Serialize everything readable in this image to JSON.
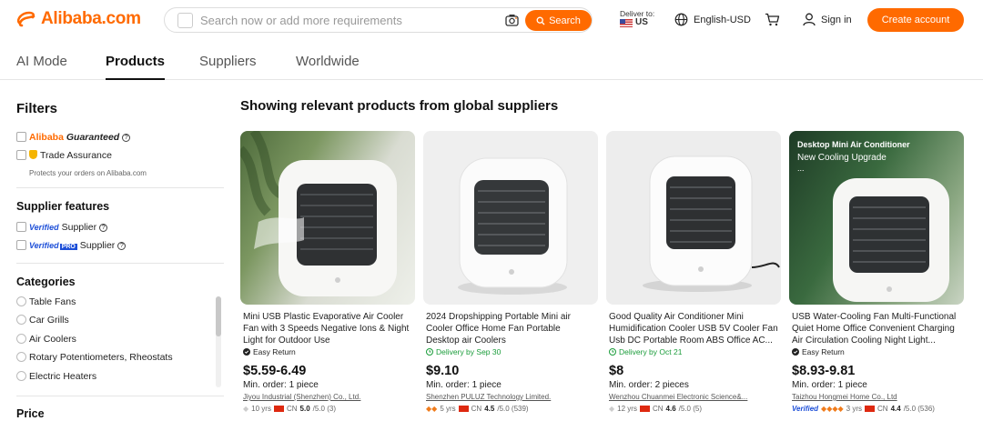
{
  "header": {
    "logo": "Alibaba.com",
    "search_placeholder": "Search now or add more requirements",
    "search_button": "Search",
    "deliver_to": "Deliver to:",
    "country": "US",
    "language": "English-USD",
    "sign_in": "Sign in",
    "create_account": "Create account"
  },
  "tabs": [
    "AI Mode",
    "Products",
    "Suppliers",
    "Worldwide"
  ],
  "filters": {
    "title": "Filters",
    "guaranteed_a": "Alibaba",
    "guaranteed_b": "Guaranteed",
    "trade_assurance": "Trade Assurance",
    "protects": "Protects your orders on Alibaba.com",
    "supplier_features_title": "Supplier features",
    "verified": "Verified",
    "verified_supplier": "Supplier",
    "verified_pro_a": "Verified",
    "verified_pro_b": "PRO",
    "verified_pro_supplier": "Supplier",
    "categories_title": "Categories",
    "categories": [
      "Table Fans",
      "Car Grills",
      "Air Coolers",
      "Rotary Potentiometers, Rheostats",
      "Electric Heaters"
    ],
    "price_title": "Price"
  },
  "main": {
    "heading": "Showing relevant products from global suppliers"
  },
  "products": [
    {
      "title": "Mini USB Plastic Evaporative Air Cooler Fan with 3 Speeds Negative Ions & Night Light for Outdoor Use",
      "badge": "Easy Return",
      "badge_color": "#222",
      "price": "$5.59-6.49",
      "moq": "Min. order: 1 piece",
      "supplier": "Jiyou Industrial (Shenzhen) Co., Ltd.",
      "years": "10 yrs",
      "country": "CN",
      "rating": "5.0",
      "rating_suffix": "/5.0 (3)"
    },
    {
      "title": "2024 Dropshipping Portable Mini air Cooler Office Home Fan Portable Desktop air Coolers",
      "badge": "Delivery by Sep 30",
      "badge_color": "#1a9c3a",
      "price": "$9.10",
      "moq": "Min. order: 1 piece",
      "supplier": "Shenzhen PULUZ Technology Limited.",
      "years": "5 yrs",
      "country": "CN",
      "rating": "4.5",
      "rating_suffix": "/5.0 (539)"
    },
    {
      "title": "Good Quality Air Conditioner Mini Humidification Cooler USB 5V Cooler Fan Usb DC Portable Room ABS Office AC...",
      "badge": "Delivery by Oct 21",
      "badge_color": "#1a9c3a",
      "price": "$8",
      "moq": "Min. order: 2 pieces",
      "supplier": "Wenzhou Chuanmei Electronic Science&...",
      "years": "12 yrs",
      "country": "CN",
      "rating": "4.6",
      "rating_suffix": "/5.0 (5)"
    },
    {
      "title": "USB Water-Cooling Fan Multi-Functional Quiet Home Office Convenient Charging Air Circulation Cooling Night Light...",
      "badge": "Easy Return",
      "badge_color": "#222",
      "price": "$8.93-9.81",
      "moq": "Min. order: 1 piece",
      "supplier": "Taizhou Hongmei Home Co., Ltd",
      "verified": "Verified",
      "years": "3 yrs",
      "country": "CN",
      "rating": "4.4",
      "rating_suffix": "/5.0 (536)"
    }
  ],
  "card4_image": {
    "title": "Desktop Mini Air Conditioner",
    "subtitle": "New Cooling Upgrade",
    "ellipsis": "..."
  }
}
